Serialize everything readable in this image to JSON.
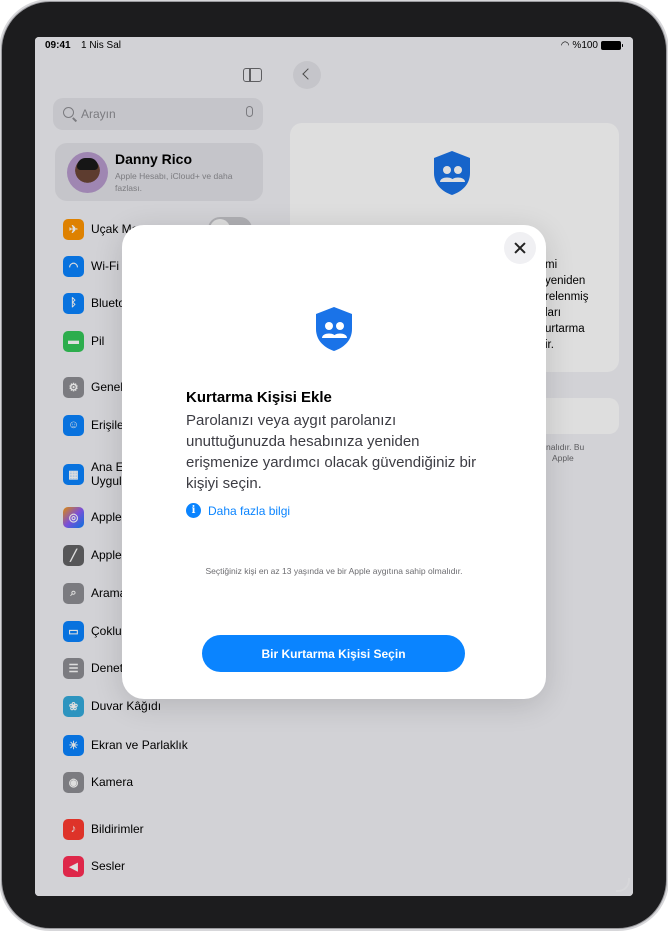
{
  "status_bar": {
    "time": "09:41",
    "date": "1 Nis Sal",
    "battery": "%100"
  },
  "search": {
    "placeholder": "Arayın"
  },
  "profile": {
    "name": "Danny Rico",
    "subtitle": "Apple Hesabı, iCloud+ ve daha fazlası."
  },
  "sidebar": {
    "items": [
      {
        "label": "Uçak Mo",
        "icon": "airplane-icon",
        "color": "#ff9500"
      },
      {
        "label": "Wi-Fi",
        "icon": "wifi-icon",
        "color": "#0a84ff"
      },
      {
        "label": "Blueto",
        "icon": "bluetooth-icon",
        "color": "#0a84ff"
      },
      {
        "label": "Pil",
        "icon": "battery-icon",
        "color": "#34c759"
      },
      {
        "label": "Genel",
        "icon": "gear-icon",
        "color": "#8e8e93"
      },
      {
        "label": "Erişile",
        "icon": "accessibility-icon",
        "color": "#0a84ff"
      },
      {
        "label": "Ana E",
        "label2": "Uygul",
        "icon": "home-screen-icon",
        "color": "#0a84ff"
      },
      {
        "label": "Apple",
        "icon": "apple-intelligence-icon",
        "color": "#8e5cf7"
      },
      {
        "label": "Apple",
        "icon": "apple-pencil-icon",
        "color": "#636366"
      },
      {
        "label": "Arama",
        "icon": "search-app-icon",
        "color": "#8e8e93"
      },
      {
        "label": "Çoklu",
        "icon": "multitasking-icon",
        "color": "#0a84ff"
      },
      {
        "label": "Denet",
        "icon": "control-center-icon",
        "color": "#8e8e93"
      },
      {
        "label": "Duvar Kâğıdı",
        "icon": "wallpaper-icon",
        "color": "#34aadc"
      },
      {
        "label": "Ekran ve Parlaklık",
        "icon": "brightness-icon",
        "color": "#0a84ff"
      },
      {
        "label": "Kamera",
        "icon": "camera-icon",
        "color": "#8e8e93"
      },
      {
        "label": "Bildirimler",
        "icon": "notifications-icon",
        "color": "#ff3b30"
      },
      {
        "label": "Sesler",
        "icon": "sounds-icon",
        "color": "#ff2d55"
      }
    ]
  },
  "detail": {
    "card_lines": [
      "mi",
      "yeniden",
      "relenmiş",
      "ları",
      "urtarma",
      "ir."
    ],
    "footer_lines": [
      "nalıdır. Bu",
      "Apple"
    ]
  },
  "modal": {
    "title": "Kurtarma Kişisi Ekle",
    "description": "Parolanızı veya aygıt parolanızı unuttuğunuzda hesabınıza yeniden erişmenize yardımcı olacak güvendiğiniz bir kişiyi seçin.",
    "learn_more": "Daha fazla bilgi",
    "note": "Seçtiğiniz kişi en az 13 yaşında ve bir Apple aygıtına sahip olmalıdır.",
    "primary_button": "Bir Kurtarma Kişisi Seçin"
  },
  "colors": {
    "accent": "#0a84ff",
    "shield": "#1a73e8"
  }
}
